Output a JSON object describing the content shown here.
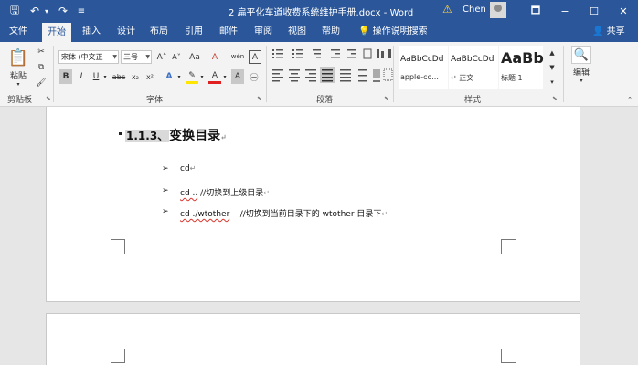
{
  "window": {
    "title": "2 扁平化车道收费系统维护手册.docx - Word",
    "user": "Chen",
    "controls": [
      "🗖",
      "−",
      "☐",
      "✕"
    ]
  },
  "quick_access": {
    "save": "🖫",
    "undo": "↶",
    "undo_drop": "▾",
    "redo": "↷",
    "customize": "≡"
  },
  "tabs": [
    "文件",
    "开始",
    "插入",
    "设计",
    "布局",
    "引用",
    "邮件",
    "审阅",
    "视图",
    "帮助"
  ],
  "active_tab": "开始",
  "tell_me": {
    "icon": "💡",
    "label": "操作说明搜索"
  },
  "share": {
    "icon": "👤",
    "label": "共享"
  },
  "ribbon": {
    "clipboard": {
      "label": "剪贴板",
      "paste": "粘贴",
      "paste_icon": "📋",
      "cut_icon": "✂",
      "copy_icon": "⧉",
      "format_painter_icon": "🖌"
    },
    "font": {
      "label": "字体",
      "font_name": "宋体 (中文正",
      "font_size": "三号",
      "grow": "A˄",
      "shrink": "A˅",
      "case": "Aa",
      "clear": "A",
      "phonetic": "wén",
      "border_char": "A",
      "bold": "B",
      "italic": "I",
      "underline": "U",
      "strike": "abc",
      "subscript": "x₂",
      "superscript": "x²",
      "effects": "A",
      "highlight": "✎",
      "font_color": "A",
      "shade": "A",
      "circle": "㊀"
    },
    "paragraph": {
      "label": "段落"
    },
    "styles": {
      "label": "样式",
      "items": [
        {
          "preview": "AaBbCcDd",
          "name": "apple-co..."
        },
        {
          "preview": "AaBbCcDd",
          "name": "↵ 正文"
        },
        {
          "preview": "AaBb",
          "name": "标题 1"
        }
      ]
    },
    "editing": {
      "label": "编辑",
      "icon": "🔍"
    }
  },
  "document": {
    "heading_number": "1.1.3、",
    "heading_text": "变换目录",
    "para_mark": "↵",
    "bullet_glyph": "➢",
    "items": [
      {
        "cmd": "cd",
        "comment": ""
      },
      {
        "cmd": "cd ..",
        "comment": "//切换到上级目录"
      },
      {
        "cmd": "cd ./wtother",
        "comment": "//切换到当前目录下的 wtother 目录下"
      }
    ]
  }
}
